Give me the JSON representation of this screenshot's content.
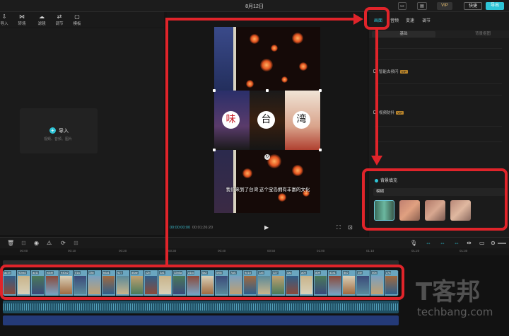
{
  "app": {
    "title": "8月12日",
    "vip_label": "VIP",
    "btn_a": "快捷",
    "btn_b": "导出"
  },
  "toolbar": {
    "items": [
      {
        "label": "导入",
        "icon": "import-icon"
      },
      {
        "label": "转场",
        "icon": "transition-icon"
      },
      {
        "label": "滤镜",
        "icon": "filter-icon"
      },
      {
        "label": "调节",
        "icon": "adjust-icon"
      },
      {
        "label": "模板",
        "icon": "template-icon"
      }
    ]
  },
  "media": {
    "import_label": "导入",
    "import_sub": "视频、音频、图片"
  },
  "preview": {
    "tiles": [
      "味",
      "台",
      "湾"
    ],
    "subtitle": "我们来到了台湾 这个宝岛拥有丰富的文化",
    "time_current": "00:00:00:00",
    "time_total": "00:01:26:20"
  },
  "right_panel": {
    "tabs": [
      "画面",
      "音频",
      "变速",
      "调节"
    ],
    "subtabs": [
      "基础",
      "背景抠图"
    ],
    "rows": [
      {
        "label": "智能去频闪",
        "badge": "VIP"
      },
      {
        "label": "视频防抖",
        "badge": "VIP"
      }
    ],
    "bg_section": {
      "title": "背景填充",
      "option": "模糊"
    }
  },
  "timeline": {
    "ticks": [
      "00:00",
      "00:10",
      "00:20",
      "00:30",
      "00:40",
      "00:50",
      "01:00",
      "01:10",
      "01:20",
      "01:30"
    ],
    "clips": [
      "ac19",
      "92bb2",
      "ac11",
      "e8d9",
      "940c2",
      "01a",
      "33b",
      "b6a1",
      "927",
      "d6ae",
      "c2b",
      "3a1",
      "32b5a",
      "a1cc",
      "5a2",
      "0f55",
      "7af1",
      "9c1d",
      "1a5",
      "327",
      "dac",
      "a09",
      "80ff",
      "d2a1",
      "8b2",
      "25f",
      "00b",
      "c7a"
    ]
  },
  "watermark": {
    "big": "T客邦",
    "small": "techbang.com"
  },
  "colors": {
    "accent": "#2ec4d6",
    "annotation": "#e0242a"
  }
}
